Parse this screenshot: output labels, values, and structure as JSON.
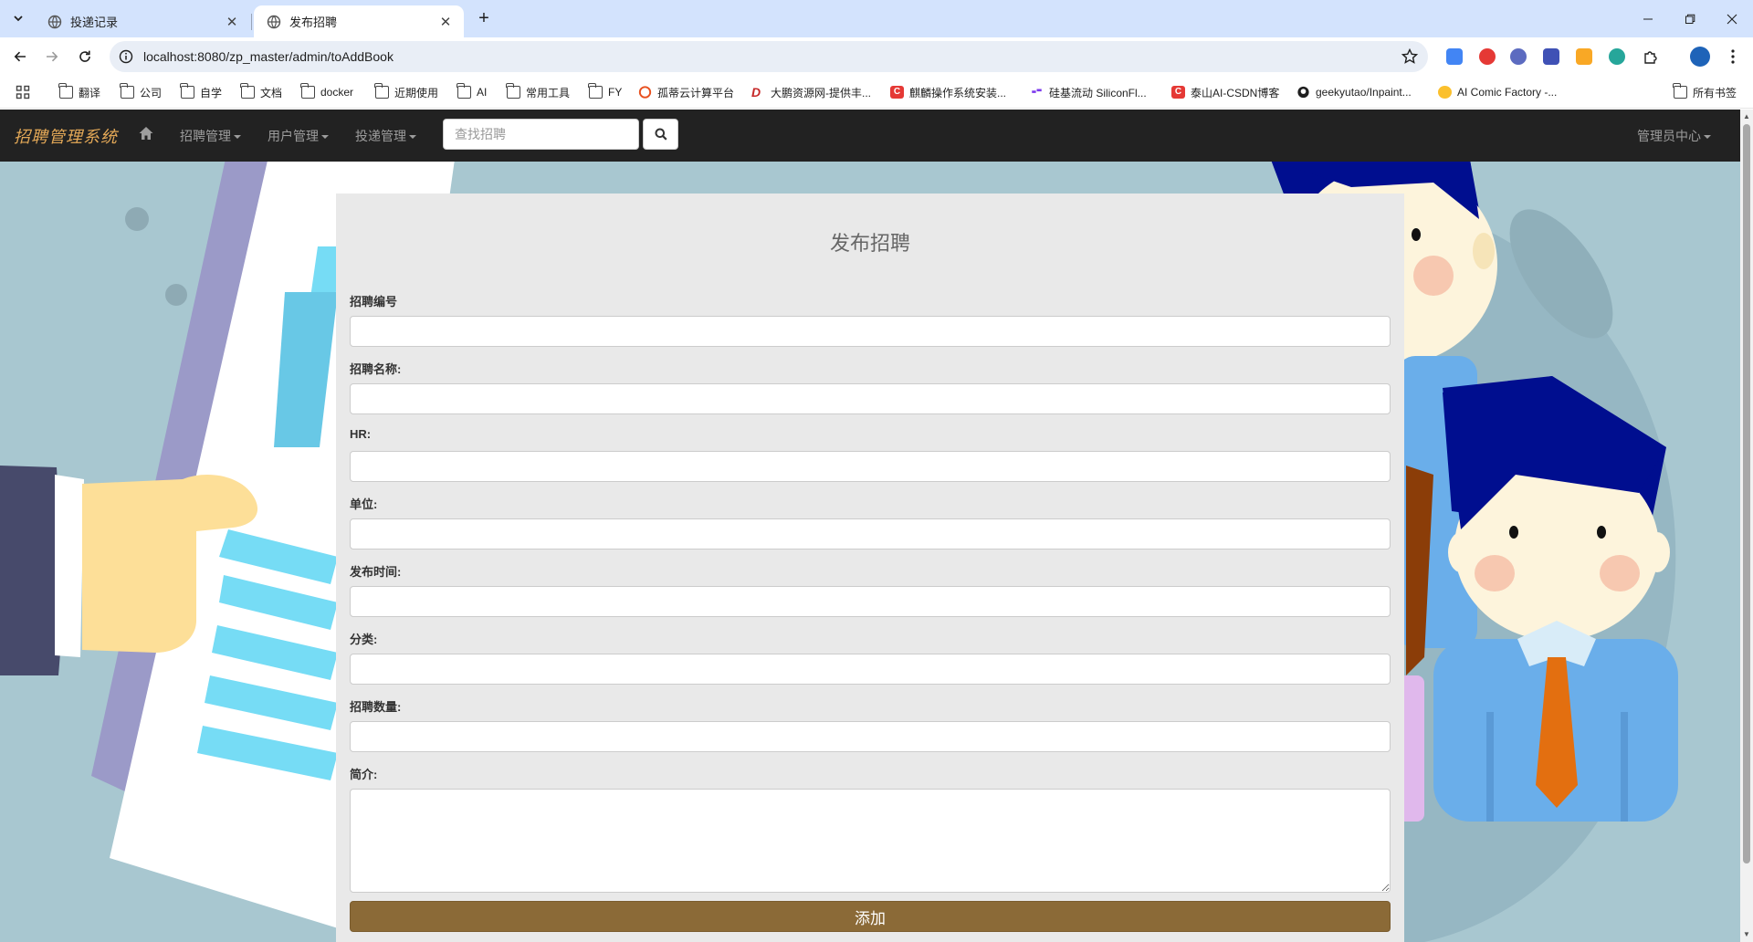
{
  "browser": {
    "tabs": [
      {
        "title": "投递记录",
        "active": false
      },
      {
        "title": "发布招聘",
        "active": true
      }
    ],
    "url": "localhost:8080/zp_master/admin/toAddBook",
    "bookmarks": [
      {
        "label": "翻译",
        "icon": "folder-icon"
      },
      {
        "label": "公司",
        "icon": "folder-icon"
      },
      {
        "label": "自学",
        "icon": "folder-icon"
      },
      {
        "label": "文档",
        "icon": "folder-icon"
      },
      {
        "label": "docker",
        "icon": "folder-icon"
      },
      {
        "label": "近期使用",
        "icon": "folder-icon"
      },
      {
        "label": "AI",
        "icon": "folder-icon"
      },
      {
        "label": "常用工具",
        "icon": "folder-icon"
      },
      {
        "label": "FY",
        "icon": "folder-icon"
      },
      {
        "label": "孤蒂云计算平台",
        "icon": "site-icon"
      },
      {
        "label": "大鹏资源网-提供丰...",
        "icon": "site-icon"
      },
      {
        "label": "麒麟操作系统安装...",
        "icon": "csdn-icon"
      },
      {
        "label": "硅基流动 SiliconFl...",
        "icon": "site-icon"
      },
      {
        "label": "泰山AI-CSDN博客",
        "icon": "csdn-icon"
      },
      {
        "label": "geekyutao/Inpaint...",
        "icon": "github-icon"
      },
      {
        "label": "AI Comic Factory -...",
        "icon": "site-icon"
      }
    ],
    "all_bookmarks": "所有书签"
  },
  "navbar": {
    "brand": "招聘管理系统",
    "menus": [
      "招聘管理",
      "用户管理",
      "投递管理"
    ],
    "search_placeholder": "查找招聘",
    "admin_menu": "管理员中心"
  },
  "form": {
    "title": "发布招聘",
    "fields": [
      {
        "label": "招聘编号",
        "value": ""
      },
      {
        "label": "招聘名称:",
        "value": ""
      },
      {
        "label": "HR:",
        "value": ""
      },
      {
        "label": "单位:",
        "value": ""
      },
      {
        "label": "发布时间:",
        "value": ""
      },
      {
        "label": "分类:",
        "value": ""
      },
      {
        "label": "招聘数量:",
        "value": ""
      },
      {
        "label": "简介:",
        "value": ""
      }
    ],
    "submit_label": "添加"
  },
  "colors": {
    "navbar_bg": "#222222",
    "brand": "#e3a857",
    "submit_bg": "#8b6a37",
    "panel_bg": "#e9e9e9",
    "page_bg": "#a8c7d0"
  }
}
